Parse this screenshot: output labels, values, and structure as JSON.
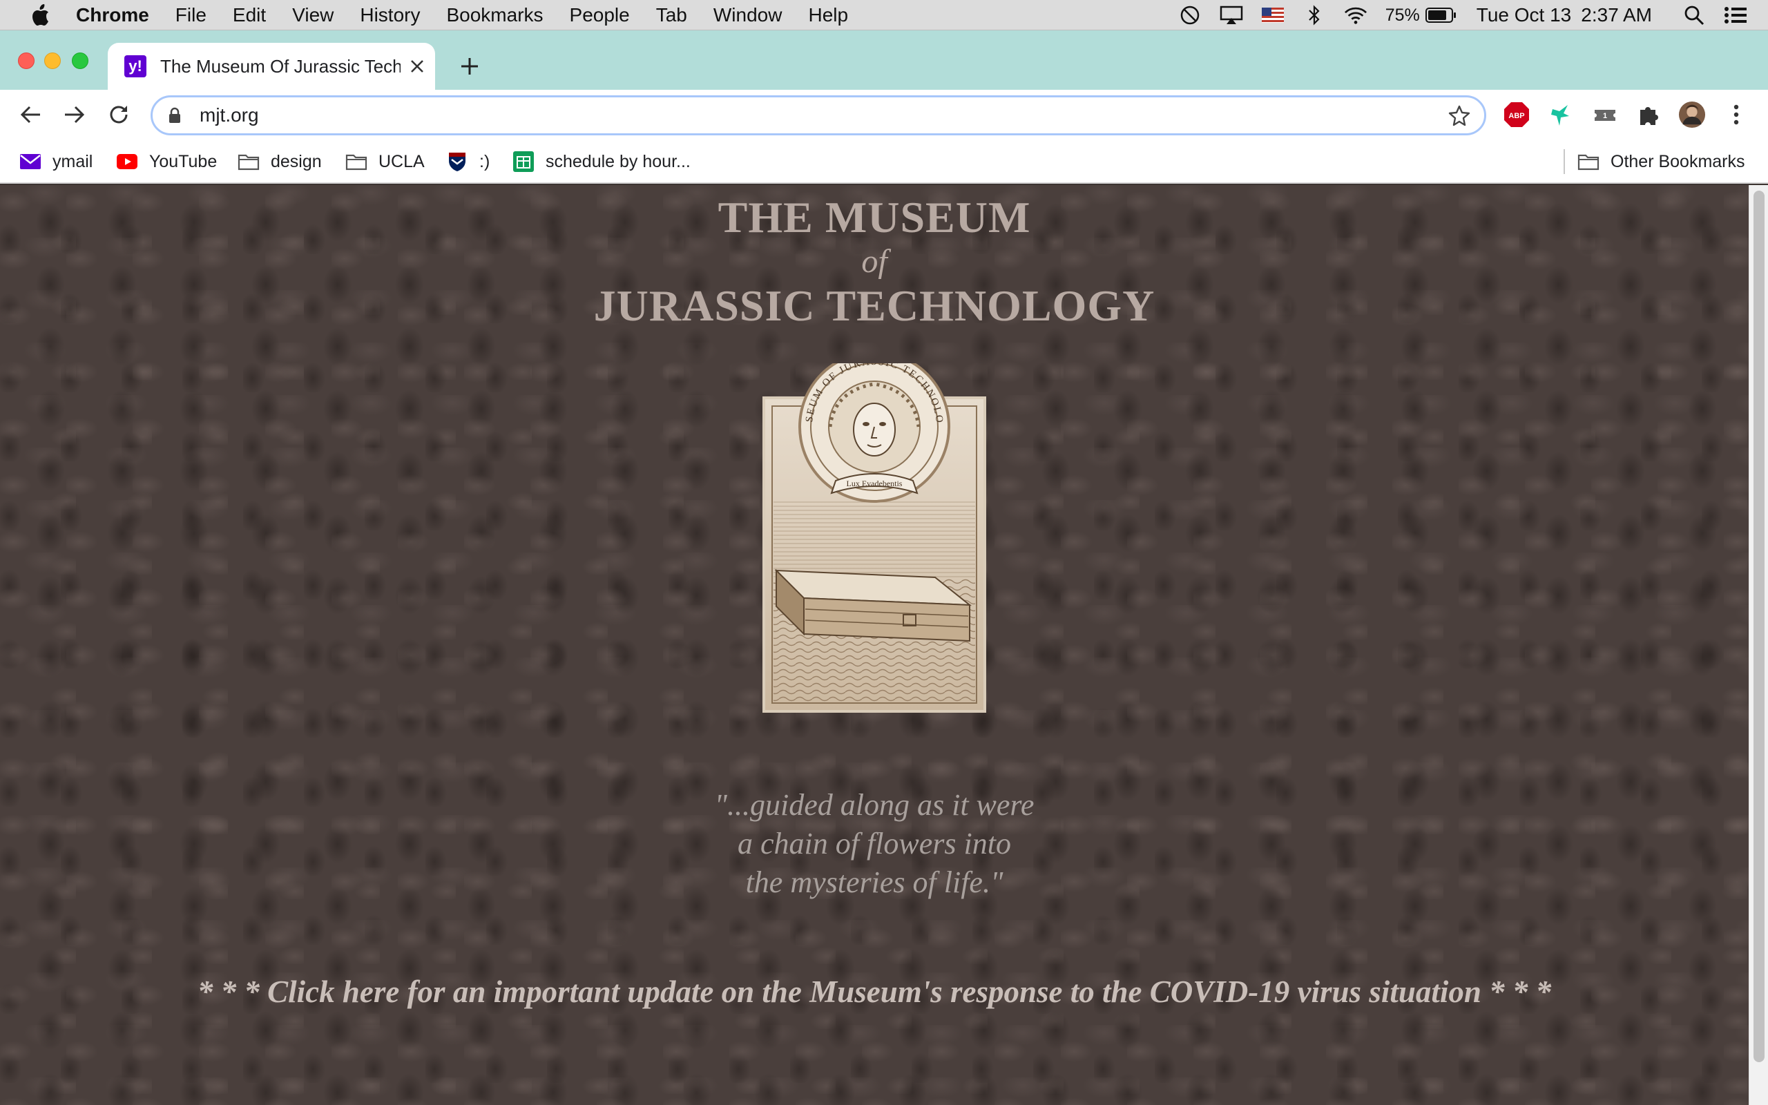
{
  "menubar": {
    "app_name": "Chrome",
    "items": [
      "File",
      "Edit",
      "View",
      "History",
      "Bookmarks",
      "People",
      "Tab",
      "Window",
      "Help"
    ],
    "battery": "75%",
    "date": "Tue Oct 13",
    "time": "2:37 AM"
  },
  "tab": {
    "favicon_text": "y!",
    "title": "The Museum Of Jurassic Techn"
  },
  "toolbar": {
    "url": "mjt.org",
    "abp_label": "ABP"
  },
  "bookmarks": {
    "items": [
      {
        "label": "ymail",
        "icon": "mail-icon"
      },
      {
        "label": "YouTube",
        "icon": "youtube-icon"
      },
      {
        "label": "design",
        "icon": "folder-icon"
      },
      {
        "label": "UCLA",
        "icon": "folder-icon"
      },
      {
        "label": ":)",
        "icon": "shield-icon"
      },
      {
        "label": "schedule by hour...",
        "icon": "sheets-icon"
      }
    ],
    "other": "Other Bookmarks"
  },
  "page": {
    "title_line1": "THE MUSEUM",
    "title_line2": "of",
    "title_line3": "JURASSIC TECHNOLOGY",
    "quote_line1": "\"...guided along as it were",
    "quote_line2": "a chain of flowers into",
    "quote_line3": "the mysteries of life.\"",
    "covid_link": "* * * Click here for an important update on the Museum's response to the COVID-19 virus situation * * *",
    "emblem_ring_text": "MUSEUM OF JURASSIC TECHNOLOGY",
    "emblem_banner_text": "Lux Evadebentis"
  },
  "colors": {
    "tabstrip": "#b2ddd9",
    "page_background": "#4a3f3c",
    "title_text": "#b7a9a2",
    "quote_text": "#a8a09c",
    "link_text": "#c9beb8"
  }
}
